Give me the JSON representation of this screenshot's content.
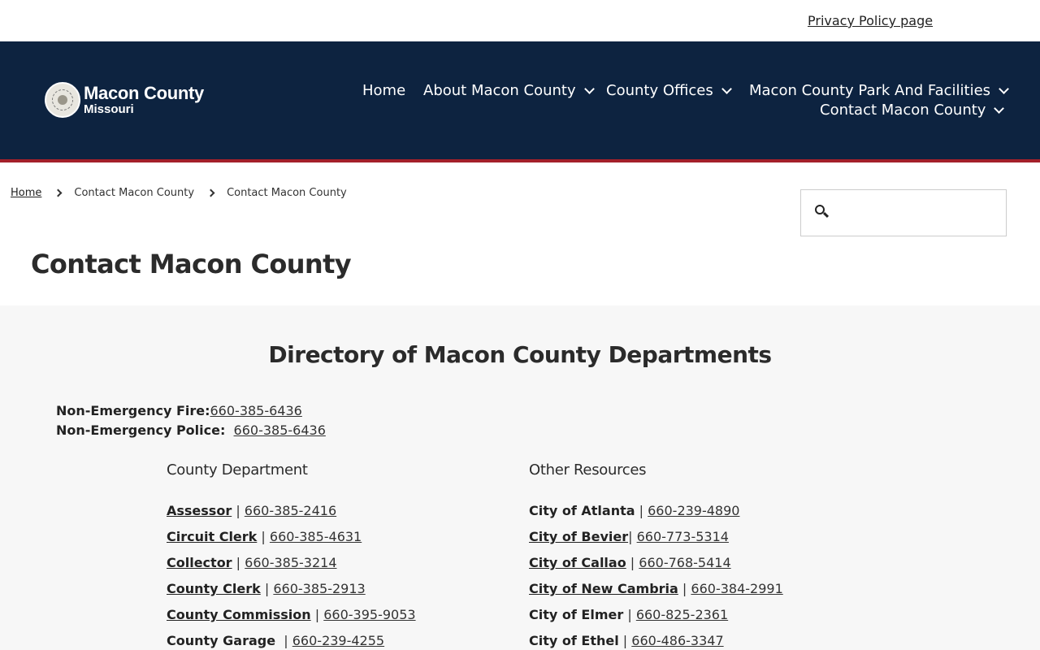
{
  "topbar": {
    "privacy_link": "Privacy Policy page"
  },
  "logo": {
    "title": "Macon County",
    "subtitle": "Missouri"
  },
  "nav": {
    "home": "Home",
    "about": "About Macon County",
    "offices": "County Offices",
    "parks": "Macon County Park And Facilities",
    "contact": "Contact Macon County"
  },
  "breadcrumb": [
    "Home",
    "Contact Macon County",
    "Contact Macon County"
  ],
  "search": {
    "placeholder": ""
  },
  "page_title": "Contact Macon County",
  "directory": {
    "title": "Directory of Macon County Departments",
    "fire_label": "Non-Emergency Fire:",
    "fire_phone": "660-385-6436",
    "police_label": "Non-Emergency Police:",
    "police_phone": "660-385-6436",
    "county_heading": "County Department",
    "other_heading": "Other Resources",
    "county": [
      {
        "name": "Assessor",
        "phone": "660-385-2416"
      },
      {
        "name": "Circuit Clerk",
        "phone": "660-385-4631"
      },
      {
        "name": "Collector",
        "phone": "660-385-3214"
      },
      {
        "name": "County Clerk",
        "phone": "660-385-2913"
      },
      {
        "name": "County Commission",
        "phone": "660-395-9053"
      },
      {
        "name": "County Garage",
        "phone": "660-239-4255"
      }
    ],
    "other": [
      {
        "name": "City of Atlanta",
        "phone": "660-239-4890"
      },
      {
        "name": "City of Bevier",
        "phone": "660-773-5314"
      },
      {
        "name": "City of Callao",
        "phone": "660-768-5414"
      },
      {
        "name": "City of New Cambria",
        "phone": "660-384-2991"
      },
      {
        "name": "City of Elmer",
        "phone": "660-825-2361"
      },
      {
        "name": "City of Ethel",
        "phone": "660-486-3347"
      }
    ],
    "separator": "|"
  }
}
